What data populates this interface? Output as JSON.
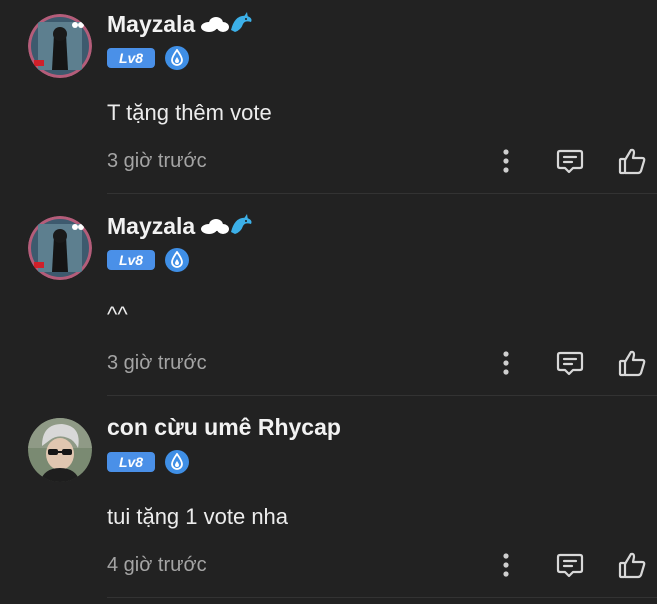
{
  "comments": [
    {
      "username": "Mayzala",
      "level": "Lv8",
      "text": "T tặng thêm vote",
      "time": "3 giờ trước"
    },
    {
      "username": "Mayzala",
      "level": "Lv8",
      "text": "^^",
      "time": "3 giờ trước"
    },
    {
      "username": "con cừu umê Rhycap",
      "level": "Lv8",
      "text": "tui tặng 1 vote nha",
      "time": "4 giờ trước"
    }
  ],
  "icons": {
    "more": "more-vertical-icon",
    "reply": "reply-comment-icon",
    "like": "thumbs-up-icon",
    "rank": "rank-drop-icon",
    "decoration": "cloud-dolphin-icon"
  },
  "colors": {
    "background": "#222222",
    "level_badge": "#4a90e8",
    "time_text": "#a4a4a4"
  }
}
